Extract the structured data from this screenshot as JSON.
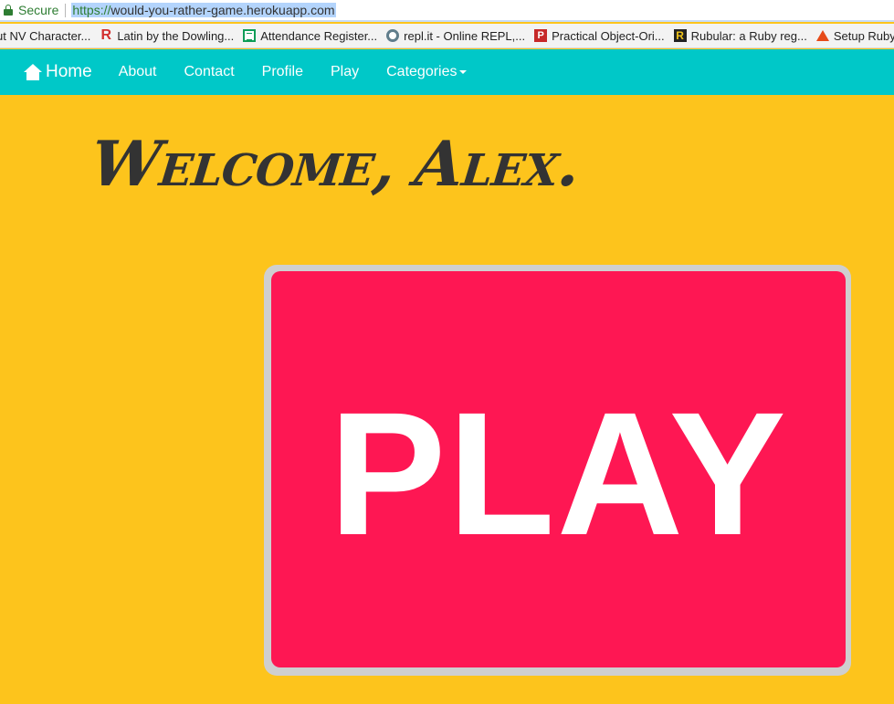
{
  "browser": {
    "secure_label": "Secure",
    "url_scheme": "https://",
    "url_rest": "would-you-rather-game.herokuapp.com"
  },
  "bookmarks": [
    {
      "label": "ut NV Character...",
      "icon": "none"
    },
    {
      "label": "Latin by the Dowling...",
      "icon": "r-logo-icon"
    },
    {
      "label": "Attendance Register...",
      "icon": "spreadsheet-icon"
    },
    {
      "label": "repl.it - Online REPL,...",
      "icon": "repl-icon"
    },
    {
      "label": "Practical Object-Ori...",
      "icon": "p-logo-icon"
    },
    {
      "label": "Rubular: a Ruby reg...",
      "icon": "rubular-icon"
    },
    {
      "label": "Setup Ruby On",
      "icon": "triangle-logo-icon"
    }
  ],
  "nav": {
    "home": "Home",
    "about": "About",
    "contact": "Contact",
    "profile": "Profile",
    "play": "Play",
    "categories": "Categories"
  },
  "main": {
    "welcome": "Welcome, Alex.",
    "play_button": "PLAY"
  },
  "colors": {
    "background": "#fdc41c",
    "navbar": "#00c8c8",
    "play_button": "#fe1753",
    "play_frame": "#cfcfcf"
  }
}
